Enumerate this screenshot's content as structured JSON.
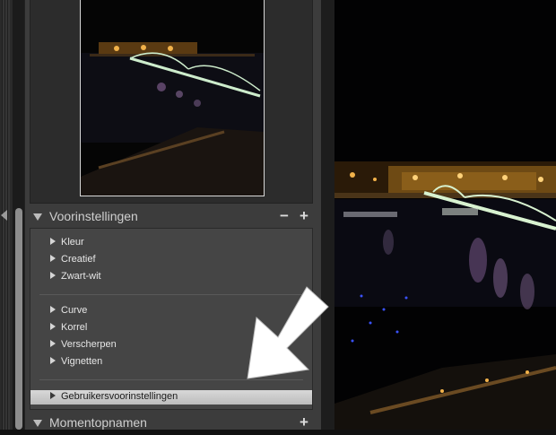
{
  "presets_panel": {
    "title": "Voorinstellingen",
    "minus_label": "−",
    "plus_label": "+",
    "groups": [
      [
        "Kleur",
        "Creatief",
        "Zwart-wit"
      ],
      [
        "Curve",
        "Korrel",
        "Verscherpen",
        "Vignetten"
      ]
    ],
    "selected_item": "Gebruikersvoorinstellingen"
  },
  "snapshots_panel": {
    "title": "Momentopnamen",
    "plus_label": "+"
  },
  "colors": {
    "panel_bg": "#3c3c3c",
    "selected_row": "#cfcfcf",
    "photo_lights": "#f2b24a",
    "bridge_lights": "#cdeccc"
  }
}
